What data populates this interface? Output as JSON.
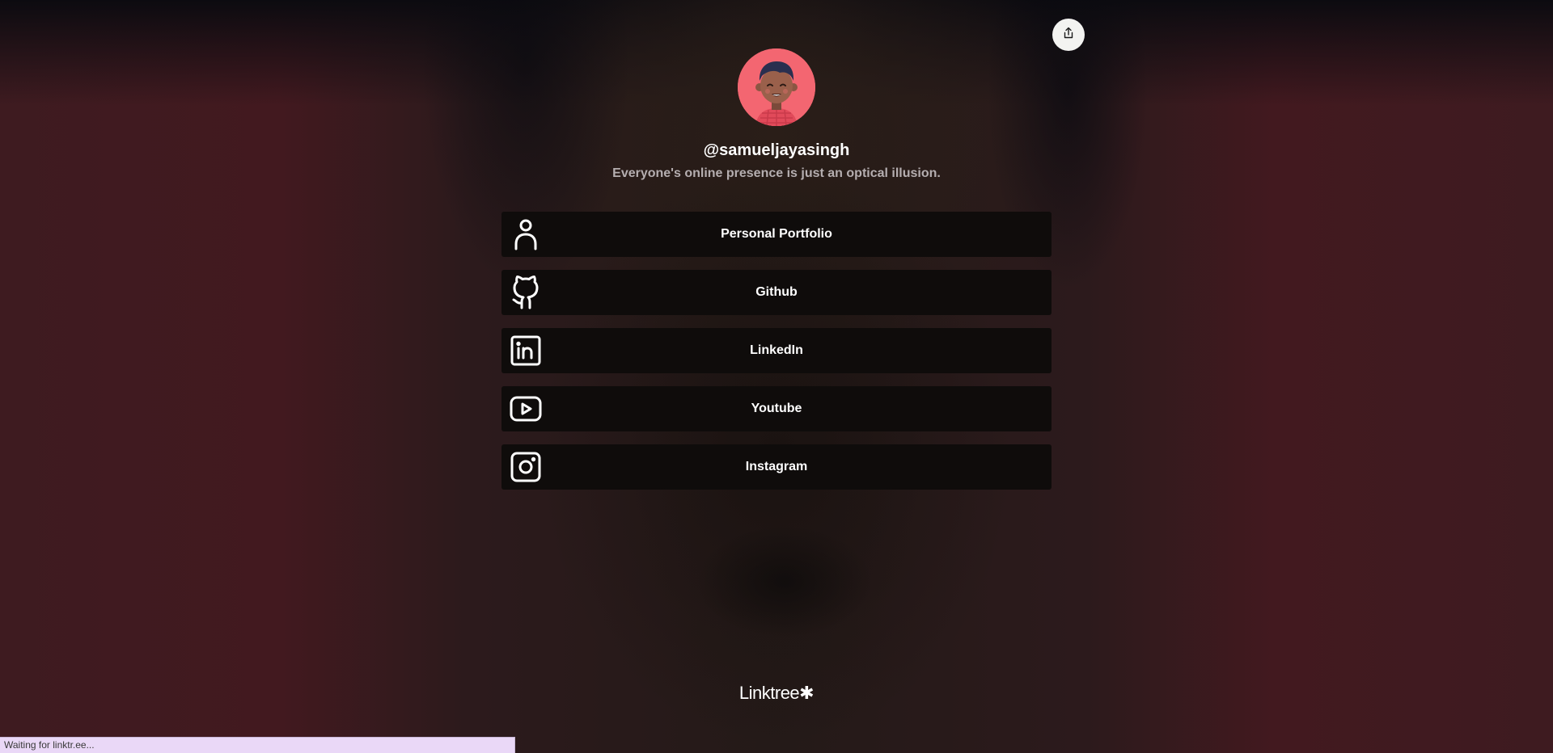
{
  "profile": {
    "username": "@samueljayasingh",
    "bio": "Everyone's online presence is just an optical illusion."
  },
  "links": [
    {
      "label": "Personal Portfolio",
      "icon": "person-icon"
    },
    {
      "label": "Github",
      "icon": "github-icon"
    },
    {
      "label": "LinkedIn",
      "icon": "linkedin-icon"
    },
    {
      "label": "Youtube",
      "icon": "youtube-icon"
    },
    {
      "label": "Instagram",
      "icon": "instagram-icon"
    }
  ],
  "footer": {
    "logo_text": "Linktree",
    "logo_mark": "✱"
  },
  "status_bar": {
    "text": "Waiting for linktr.ee..."
  },
  "icons": {
    "share": "share-icon"
  },
  "colors": {
    "avatar_bg": "#f36671",
    "card_bg": "#0f0c0b",
    "text": "#ffffff",
    "bio_text": "#b5aeb0",
    "status_bg": "#ead8f7"
  }
}
